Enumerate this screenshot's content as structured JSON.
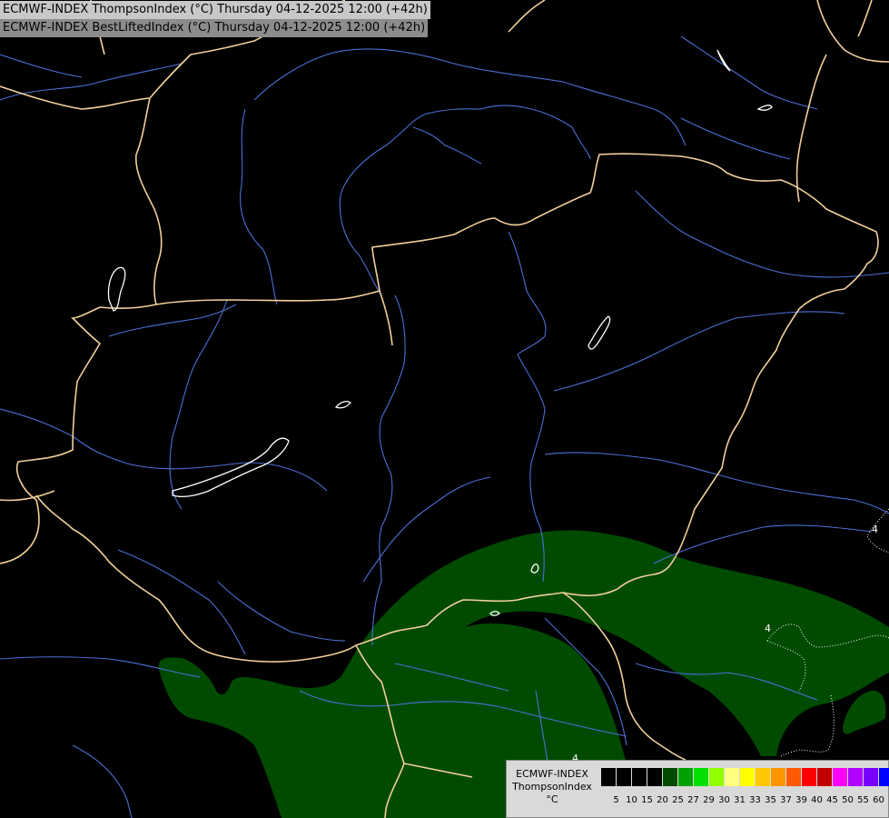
{
  "titles": {
    "line1": "ECMWF-INDEX ThompsonIndex (°C) Thursday 04-12-2025 12:00 (+42h)",
    "line2": "ECMWF-INDEX BestLiftedIndex (°C) Thursday 04-12-2025 12:00 (+42h)"
  },
  "legend": {
    "line1": "ECMWF-INDEX",
    "line2": "ThompsonIndex",
    "line3": "°C",
    "ticks": [
      "5",
      "10",
      "15",
      "20",
      "25",
      "27",
      "29",
      "30",
      "31",
      "33",
      "35",
      "37",
      "39",
      "40",
      "45",
      "50",
      "55",
      "60"
    ],
    "colors": [
      "#000000",
      "#000000",
      "#000000",
      "#000000",
      "#004b00",
      "#00a000",
      "#00e000",
      "#90ff00",
      "#ffff80",
      "#ffff00",
      "#ffc800",
      "#ff9600",
      "#ff5a00",
      "#ff0000",
      "#c00000",
      "#ff00ff",
      "#b000ff",
      "#7800ff",
      "#0000ff"
    ]
  },
  "contour_labels": [
    "4",
    "4",
    "4"
  ],
  "colors": {
    "background": "#000000",
    "border": "#f2cf9a",
    "river": "#4d6fd6",
    "field_green": "#004b00",
    "lake_outline": "#ffffff"
  }
}
